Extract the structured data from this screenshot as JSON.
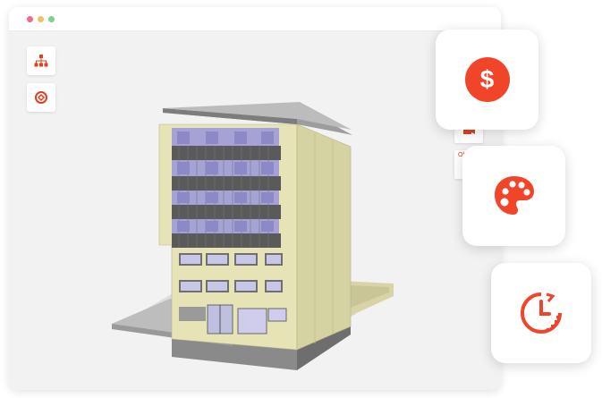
{
  "window": {
    "title_dots": [
      "close",
      "minimize",
      "maximize"
    ]
  },
  "toolbar": {
    "hierarchy_icon": "hierarchy-icon",
    "section_icon": "section-box-icon"
  },
  "side_tools": {
    "camera_icon": "camera-icon",
    "object_label": "Obj",
    "cursor_icon": "cursor-arrow-icon"
  },
  "cards": [
    {
      "name": "cost",
      "icon": "dollar-icon",
      "symbol": "$"
    },
    {
      "name": "appearance",
      "icon": "palette-icon"
    },
    {
      "name": "schedule",
      "icon": "clock-history-icon"
    }
  ],
  "colors": {
    "accent": "#f1452a",
    "window_bg": "#f2f2f2",
    "facade": "#e6e4b6",
    "glass": "#a7a2d6"
  }
}
